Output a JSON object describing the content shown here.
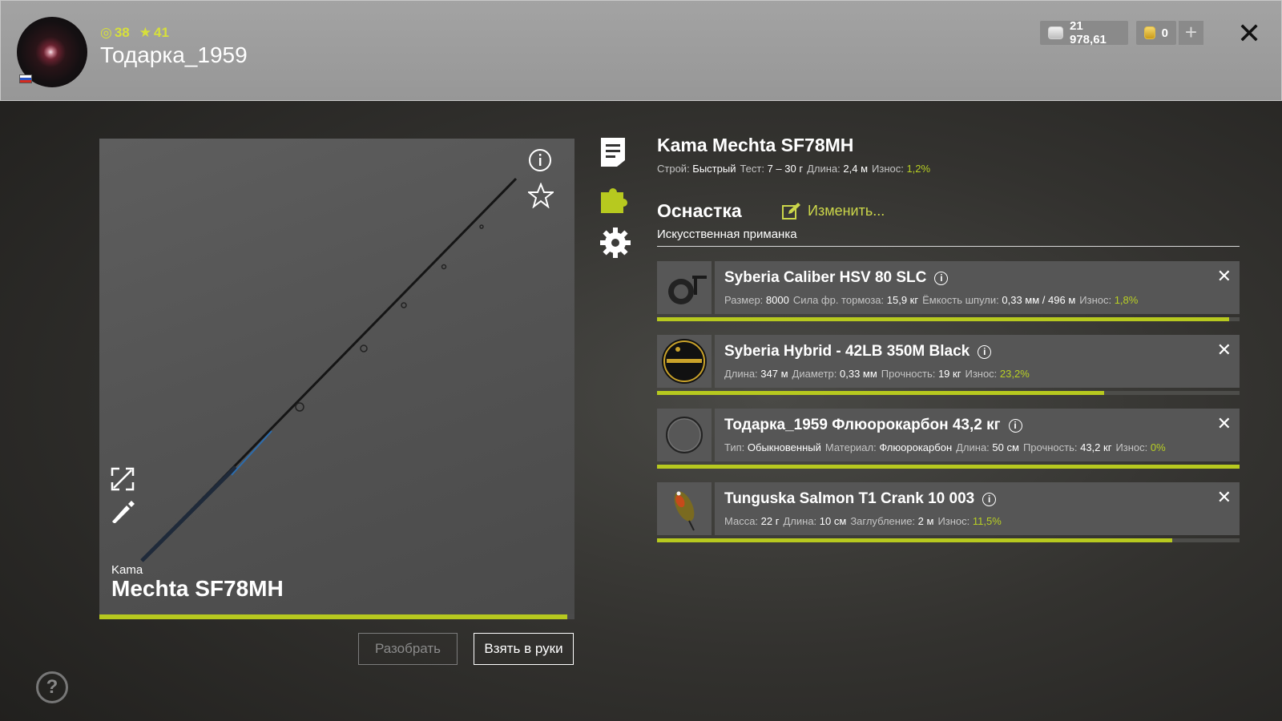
{
  "header": {
    "level": "38",
    "rank": "41",
    "username": "Тодарка_1959",
    "silver": "21 978,61",
    "gold": "0",
    "add_label": "+",
    "close_label": "✕"
  },
  "rod": {
    "brand": "Kama",
    "model": "Mechta SF78MH",
    "wear_fraction": 0.984,
    "disassemble_label": "Разобрать",
    "take_label": "Взять в руки"
  },
  "details": {
    "title": "Kama Mechta SF78MH",
    "stats": [
      {
        "label": "Строй:",
        "value": "Быстрый"
      },
      {
        "label": "Тест:",
        "value": "7 – 30 г"
      },
      {
        "label": "Длина:",
        "value": "2,4 м"
      },
      {
        "label": "Износ:",
        "value": "1,2%",
        "accent": true
      }
    ],
    "section_title": "Оснастка",
    "edit_label": "Изменить...",
    "rig_type": "Искусственная приманка"
  },
  "slots": [
    {
      "name": "Syberia Caliber HSV 80 SLC",
      "props": [
        {
          "label": "Размер:",
          "value": "8000"
        },
        {
          "label": "Сила фр. тормоза:",
          "value": "15,9 кг"
        },
        {
          "label": "Ёмкость шпули:",
          "value": "0,33 мм / 496 м"
        },
        {
          "label": "Износ:",
          "value": "1,8%",
          "accent": true
        }
      ],
      "condition": 0.982
    },
    {
      "name": "Syberia Hybrid - 42LB 350M Black",
      "props": [
        {
          "label": "Длина:",
          "value": "347 м"
        },
        {
          "label": "Диаметр:",
          "value": "0,33 мм"
        },
        {
          "label": "Прочность:",
          "value": "19 кг"
        },
        {
          "label": "Износ:",
          "value": "23,2%",
          "accent": true
        }
      ],
      "condition": 0.768
    },
    {
      "name": "Тодарка_1959 Флюорокарбон 43,2 кг",
      "props": [
        {
          "label": "Тип:",
          "value": "Обыкновенный"
        },
        {
          "label": "Материал:",
          "value": "Флюорокарбон"
        },
        {
          "label": "Длина:",
          "value": "50 см"
        },
        {
          "label": "Прочность:",
          "value": "43,2 кг"
        },
        {
          "label": "Износ:",
          "value": "0%",
          "accent": true
        }
      ],
      "condition": 1.0
    },
    {
      "name": "Tunguska Salmon T1 Crank 10 003",
      "props": [
        {
          "label": "Масса:",
          "value": "22 г"
        },
        {
          "label": "Длина:",
          "value": "10 см"
        },
        {
          "label": "Заглубление:",
          "value": "2 м"
        },
        {
          "label": "Износ:",
          "value": "11,5%",
          "accent": true
        }
      ],
      "condition": 0.885
    }
  ],
  "icons": {
    "level": "circle-icon",
    "rank": "star-icon",
    "silver": "silver-coin-icon",
    "gold": "gold-coin-icon"
  },
  "colors": {
    "accent": "#b7c91f",
    "header_bg": "#9d9d9d"
  }
}
